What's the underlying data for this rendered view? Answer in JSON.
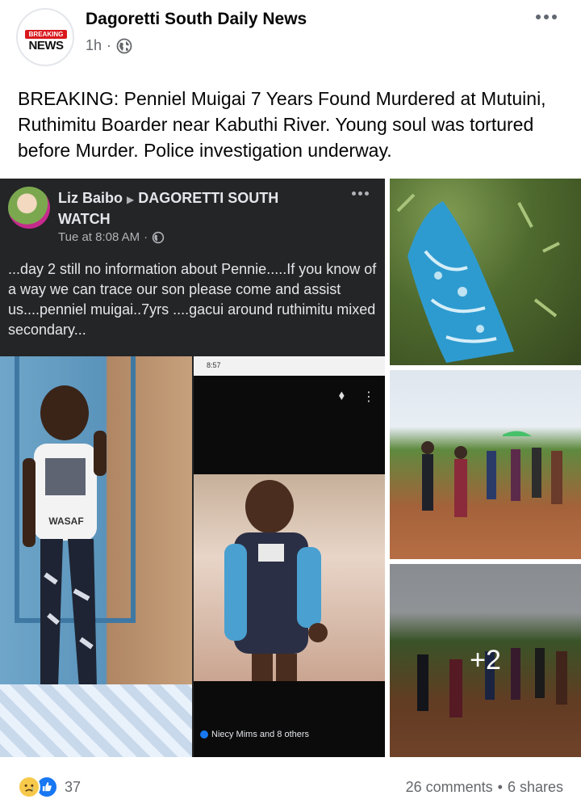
{
  "post": {
    "page_name": "Dagoretti South Daily News",
    "avatar_top": "BREAKING",
    "avatar_bottom": "NEWS",
    "time": "1h",
    "separator": "·",
    "caption": "BREAKING: Penniel Muigai 7 Years Found Murdered at Mutuini, Ruthimitu Boarder near Kabuthi River. Young soul was tortured before Murder. Police investigation underway."
  },
  "embedded_post": {
    "author": "Liz Baibo",
    "target": "DAGORETTI SOUTH WATCH",
    "time": "Tue at 8:08 AM",
    "separator": "·",
    "text": "...day 2 still no information about Pennie.....If you know of a way we can trace our son please come and assist us....penniel muigai..7yrs ....gacui around ruthimitu mixed secondary...",
    "phone_status": "8:57",
    "phone_reactions": "Niecy Mims and 8 others",
    "shirt_text": "WASAF"
  },
  "media": {
    "more_count": "+2"
  },
  "footer": {
    "reaction_count": "37",
    "comments": "26 comments",
    "dot": "•",
    "shares": "6 shares"
  },
  "colors": {
    "text_primary": "#050505",
    "text_secondary": "#65676b",
    "brand_red": "#d8171c",
    "facebook_blue": "#1877f2",
    "dark_post_bg": "#242526"
  },
  "icons": {
    "privacy": "globe-icon",
    "options": "more-options-icon",
    "reactions": [
      "sad-reaction-icon",
      "like-reaction-icon"
    ]
  }
}
